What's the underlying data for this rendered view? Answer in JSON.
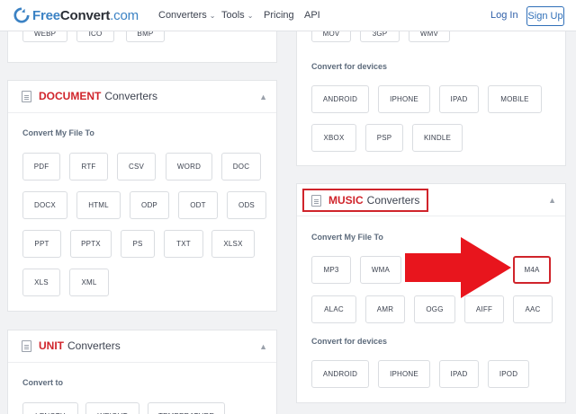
{
  "header": {
    "logo_free": "Free",
    "logo_convert": "Convert",
    "logo_com": ".com",
    "nav": [
      {
        "label": "Converters",
        "dropdown": true
      },
      {
        "label": "Tools",
        "dropdown": true
      },
      {
        "label": "Pricing",
        "dropdown": false
      },
      {
        "label": "API",
        "dropdown": false
      }
    ],
    "login": "Log In",
    "signup": "Sign Up"
  },
  "image_card": {
    "formats": [
      "WEBP",
      "ICO",
      "BMP"
    ]
  },
  "document_card": {
    "title_highlight": "DOCUMENT",
    "title_rest": "Converters",
    "section_label": "Convert My File To",
    "formats": [
      "PDF",
      "RTF",
      "CSV",
      "WORD",
      "DOC",
      "DOCX",
      "HTML",
      "ODP",
      "ODT",
      "ODS",
      "PPT",
      "PPTX",
      "PS",
      "TXT",
      "XLSX",
      "XLS",
      "XML"
    ]
  },
  "unit_card": {
    "title_highlight": "UNIT",
    "title_rest": "Converters",
    "section_label": "Convert to",
    "formats": [
      "LENGTH",
      "WEIGHT",
      "TEMPERATURE"
    ]
  },
  "video_card": {
    "formats": [
      "MOV",
      "3GP",
      "WMV"
    ],
    "devices_label": "Convert for devices",
    "devices": [
      "ANDROID",
      "IPHONE",
      "IPAD",
      "MOBILE",
      "XBOX",
      "PSP",
      "KINDLE"
    ]
  },
  "music_card": {
    "title_highlight": "MUSIC",
    "title_rest": "Converters",
    "section_label": "Convert My File To",
    "formats": [
      "MP3",
      "WMA",
      "M4A",
      "ALAC",
      "AMR",
      "OGG",
      "AIFF",
      "AAC"
    ],
    "devices_label": "Convert for devices",
    "devices": [
      "ANDROID",
      "IPHONE",
      "IPAD",
      "IPOD"
    ]
  },
  "colors": {
    "accent_red": "#d0242b",
    "brand_blue": "#3b82c4",
    "annotation_arrow": "#e8151d"
  }
}
